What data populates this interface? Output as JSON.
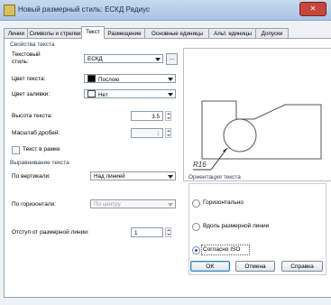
{
  "window": {
    "title": "Новый размерный стиль: ЕСКД Радиус",
    "close_label": "✕"
  },
  "tabs": [
    {
      "label": "Линии",
      "active": false
    },
    {
      "label": "Символы и стрелки",
      "active": false
    },
    {
      "label": "Текст",
      "active": true
    },
    {
      "label": "Размещение",
      "active": false
    },
    {
      "label": "Основные единицы",
      "active": false
    },
    {
      "label": "Альт. единицы",
      "active": false
    },
    {
      "label": "Допуски",
      "active": false
    }
  ],
  "text_props": {
    "group_title": "Свойства текста",
    "style_label_1": "Текстовый",
    "style_label_2": "стиль:",
    "style_value": "ЕСКД",
    "style_button": "...",
    "color_label": "Цвет текста:",
    "color_value": "Послою",
    "color_swatch": "#000000",
    "fill_label": "Цвет заливки:",
    "fill_value": "Нет",
    "height_label": "Высота текста:",
    "height_value": "3.5",
    "fraction_label": "Масштаб дробей:",
    "fraction_value": "1",
    "frame_label": "Текст в рамке",
    "frame_checked": false
  },
  "alignment": {
    "group_title": "Выравнивание текста",
    "vertical_label": "По вертикали:",
    "vertical_value": "Над линией",
    "horizontal_label": "По горизонтали:",
    "horizontal_value": "По центру",
    "offset_label": "Отступ от размерной линии:",
    "offset_value": "1"
  },
  "preview": {
    "dimension_text": "R16"
  },
  "orientation": {
    "group_title": "Ориентация текста",
    "options": [
      {
        "label": "Горизонтально",
        "selected": false
      },
      {
        "label": "Вдоль размерной линии",
        "selected": false
      },
      {
        "label": "Согласно ISO",
        "selected": true
      }
    ]
  },
  "buttons": {
    "ok": "OK",
    "cancel": "Отмена",
    "help": "Справка"
  }
}
